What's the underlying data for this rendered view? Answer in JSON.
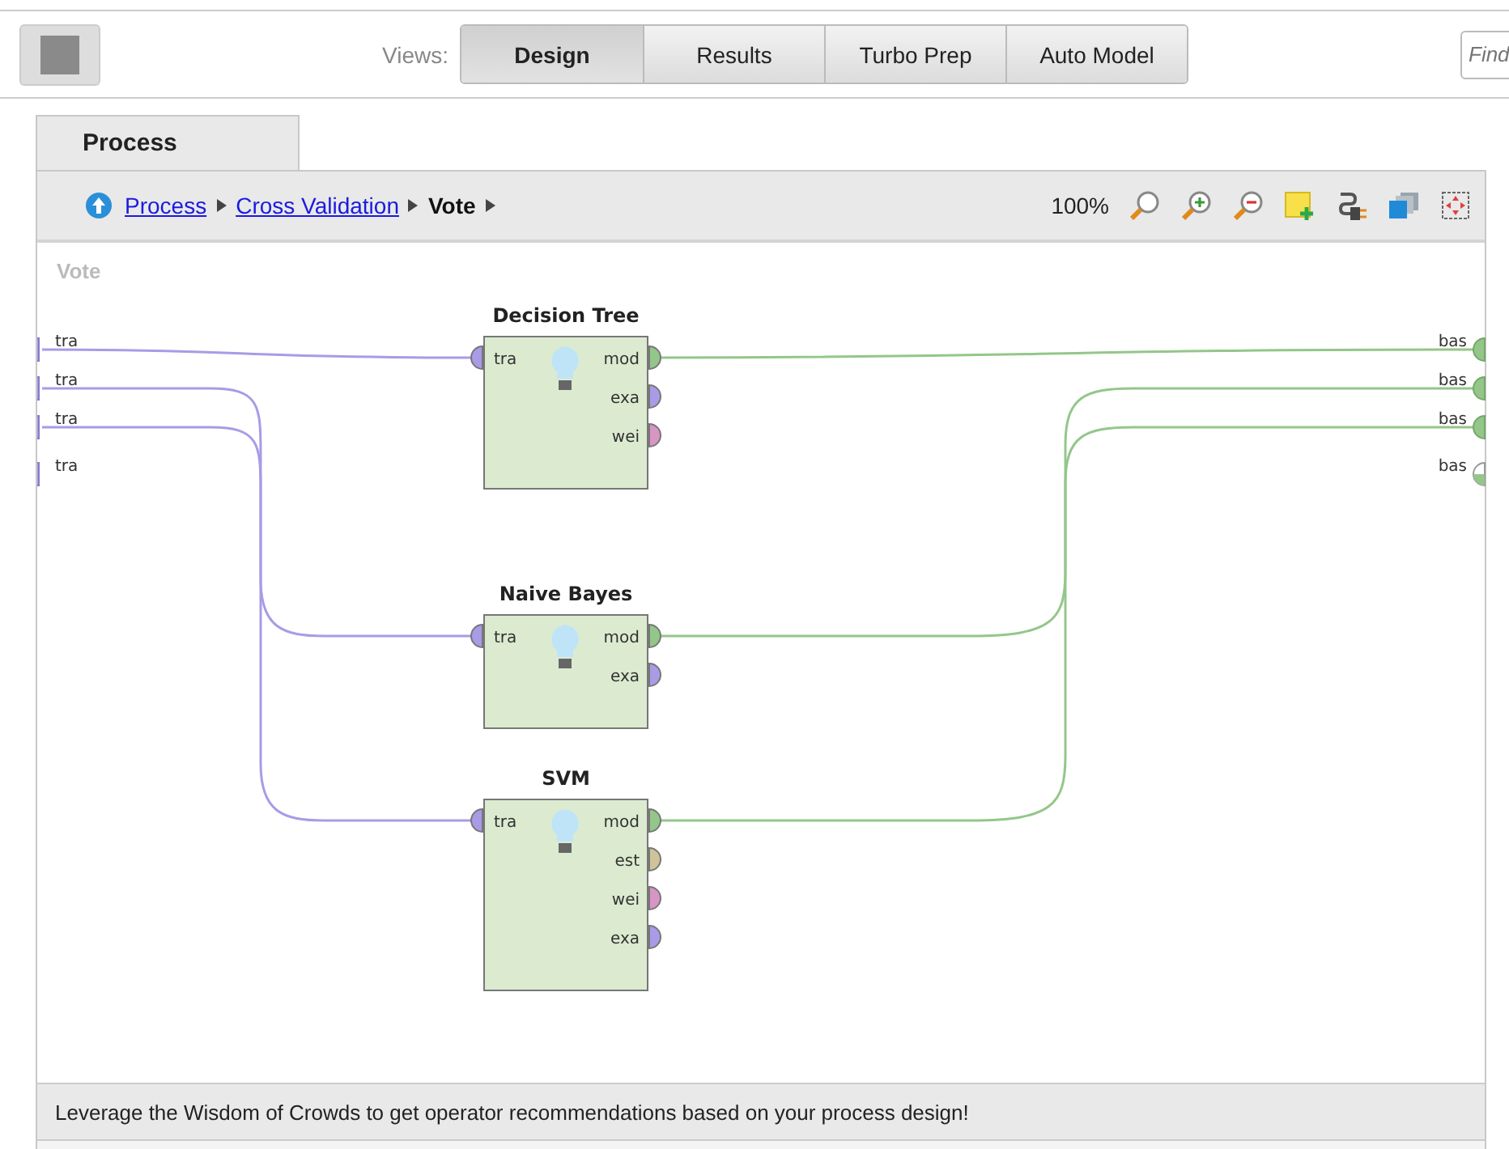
{
  "toolbar": {
    "views_label": "Views:",
    "views": [
      {
        "label": "Design",
        "selected": true
      },
      {
        "label": "Results",
        "selected": false
      },
      {
        "label": "Turbo Prep",
        "selected": false
      },
      {
        "label": "Auto Model",
        "selected": false
      }
    ],
    "search": {
      "placeholder": "Find"
    }
  },
  "panel_tab": {
    "label": "Process"
  },
  "breadcrumb": [
    {
      "label": "Process",
      "kind": "link"
    },
    {
      "label": "Cross Validation",
      "kind": "link"
    },
    {
      "label": "Vote",
      "kind": "current"
    }
  ],
  "zoom_level": "100%",
  "canvas": {
    "title": "Vote",
    "inputs": [
      {
        "label": "tra"
      },
      {
        "label": "tra"
      },
      {
        "label": "tra"
      },
      {
        "label": "tra"
      }
    ],
    "outputs": [
      {
        "label": "bas",
        "connected": true
      },
      {
        "label": "bas",
        "connected": true
      },
      {
        "label": "bas",
        "connected": true
      },
      {
        "label": "bas",
        "connected": false
      }
    ],
    "operators": [
      {
        "name": "Decision Tree",
        "ports_in": [
          {
            "label": "tra",
            "color": "#a99be6"
          }
        ],
        "ports_out": [
          {
            "label": "mod",
            "color": "#94c68a"
          },
          {
            "label": "exa",
            "color": "#a99be6"
          },
          {
            "label": "wei",
            "color": "#d795c4"
          }
        ]
      },
      {
        "name": "Naive Bayes",
        "ports_in": [
          {
            "label": "tra",
            "color": "#a99be6"
          }
        ],
        "ports_out": [
          {
            "label": "mod",
            "color": "#94c68a"
          },
          {
            "label": "exa",
            "color": "#a99be6"
          }
        ]
      },
      {
        "name": "SVM",
        "ports_in": [
          {
            "label": "tra",
            "color": "#a99be6"
          }
        ],
        "ports_out": [
          {
            "label": "mod",
            "color": "#94c68a"
          },
          {
            "label": "est",
            "color": "#cfc39a"
          },
          {
            "label": "wei",
            "color": "#d795c4"
          },
          {
            "label": "exa",
            "color": "#a99be6"
          }
        ]
      }
    ]
  },
  "hint": "Leverage the Wisdom of Crowds to get operator recommendations based on your process design!"
}
